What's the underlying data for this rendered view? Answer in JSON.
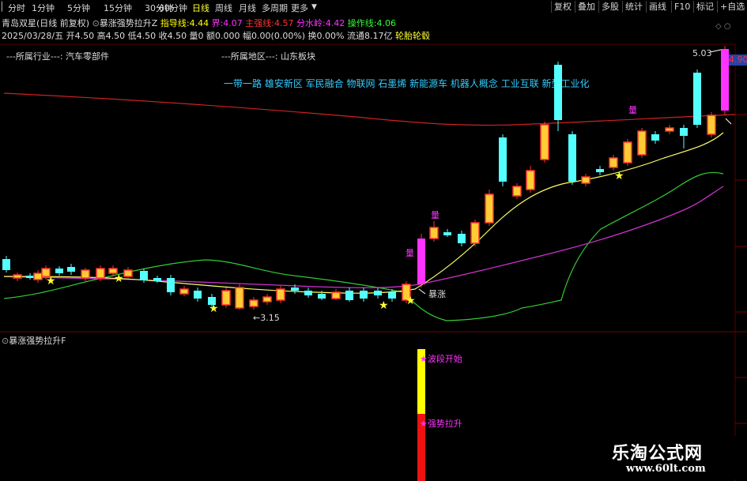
{
  "toolbar": {
    "periods": [
      "分时",
      "1分钟",
      "5分钟",
      "15分钟",
      "30分钟",
      "60分钟",
      "日线",
      "周线",
      "月线",
      "多周期",
      "更多"
    ],
    "active_period": "日线",
    "right_buttons": [
      "复权",
      "叠加",
      "多股",
      "统计",
      "画线",
      "F10",
      "标记",
      "+自选"
    ]
  },
  "header": {
    "stock_name": "青岛双星",
    "mode": "(日线 前复权)",
    "indicator_name": "暴涨强势拉升Z",
    "indicator_values": [
      {
        "label": "指导线:",
        "value": "4.44",
        "color": "#ffff00"
      },
      {
        "label": "界:",
        "value": "4.07",
        "color": "#ff33ff"
      },
      {
        "label": "主强线:",
        "value": "4.57",
        "color": "#ff3333"
      },
      {
        "label": "分水岭:",
        "value": "4.42",
        "color": "#ff33ff"
      },
      {
        "label": "操作线:",
        "value": "4.06",
        "color": "#33ff33"
      }
    ],
    "quote_line": "2025/03/28/五 开4.50 高4.50 低4.50 收4.50 量0 额0.000 幅0.00(0.00%) 换0.00% 流通8.17亿",
    "quote_tag": "轮胎轮毂",
    "industry_label": "---所属行业---:",
    "industry_value": "汽车零部件",
    "region_label": "---所属地区---:",
    "region_value": "山东板块",
    "concepts": "一带一路 雄安新区 军民融合 物联网 石墨烯 新能源车 机器人概念 工业互联 新型工业化"
  },
  "main_chart": {
    "price_high_label": "5.03",
    "price_low_label": "3.15",
    "axis_tag": "4.90",
    "surge_label": "暴涨",
    "big_candle_marker": "量"
  },
  "sub_panel": {
    "title": "暴涨强势拉升F",
    "label_top": "波段开始",
    "label_bottom": "强势拉升"
  },
  "watermark": {
    "line1": "乐淘公式网",
    "line2": "www.60lt.com"
  },
  "colors": {
    "up": "#ff3333",
    "down": "#54ffff",
    "yellow_body": "#ffcc33",
    "magenta": "#ff33ff",
    "ma_yellow": "#ffff66",
    "ma_magenta": "#cc33cc",
    "ma_green": "#33cc33",
    "ma_red": "#cc2222"
  }
}
